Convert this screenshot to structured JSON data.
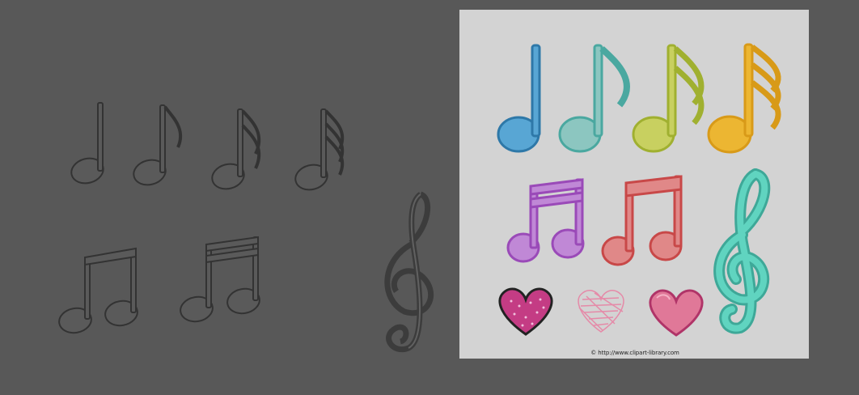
{
  "scene": {
    "background_color": "#585858",
    "panel_color": "#d3d3d3",
    "grey_model_color": "#5c5c5c",
    "grey_model_outline": "#3a3a3a"
  },
  "texture_sheet": {
    "credit_text": "© http://www.clipart-library.com",
    "colors": {
      "quarter": "#58a6d4",
      "eighth": "#6cc0b6",
      "sixteenth": "#b8c64a",
      "thirty_second": "#ecb632",
      "beamed_pair_1": "#b56ad0",
      "beamed_pair_2": "#e07070",
      "treble_clef": "#4ec8b0",
      "heart_dotted": "#c43c84",
      "heart_scribble": "#e58aa8",
      "heart_plain": "#e07898"
    }
  }
}
